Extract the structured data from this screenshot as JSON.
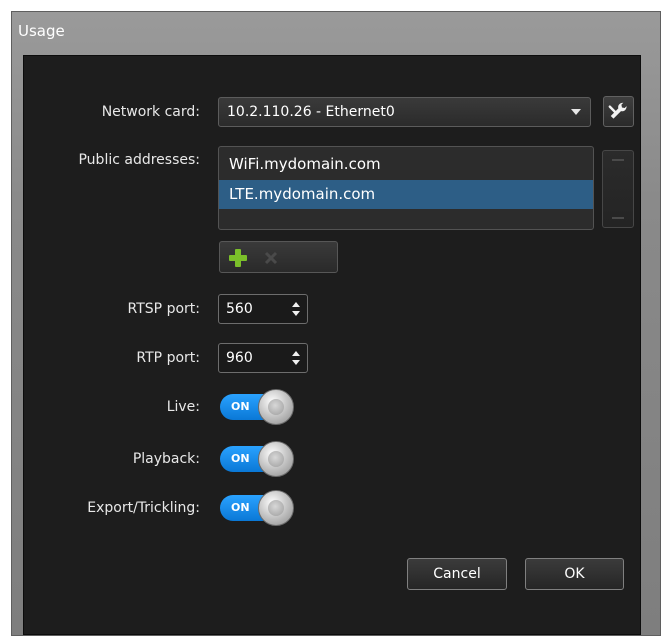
{
  "window": {
    "title": "Usage"
  },
  "network_card": {
    "label": "Network card:",
    "value": "10.2.110.26 - Ethernet0"
  },
  "public_addresses": {
    "label": "Public addresses:",
    "items": [
      {
        "text": "WiFi.mydomain.com",
        "selected": false
      },
      {
        "text": "LTE.mydomain.com",
        "selected": true
      }
    ]
  },
  "rtsp_port": {
    "label": "RTSP port:",
    "value": "560"
  },
  "rtp_port": {
    "label": "RTP port:",
    "value": "960"
  },
  "toggles": {
    "live": {
      "label": "Live:",
      "state": "ON"
    },
    "playback": {
      "label": "Playback:",
      "state": "ON"
    },
    "export": {
      "label": "Export/Trickling:",
      "state": "ON"
    }
  },
  "buttons": {
    "cancel": "Cancel",
    "ok": "OK"
  },
  "colors": {
    "accent": "#0a78d6",
    "selection": "#2d5e86",
    "add": "#7bbf2a"
  },
  "icons": [
    "dropdown-arrow-icon",
    "wrench-icon",
    "add-icon",
    "remove-icon",
    "spin-arrows-icon"
  ]
}
